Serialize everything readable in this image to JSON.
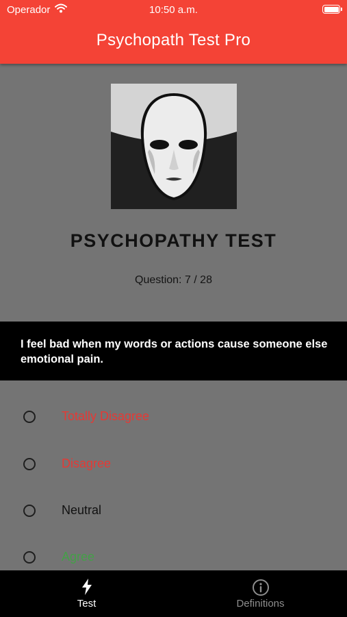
{
  "status_bar": {
    "carrier": "Operador",
    "time": "10:50 a.m."
  },
  "header": {
    "title": "Psychopath Test Pro"
  },
  "main": {
    "title": "PSYCHOPATHY TEST",
    "question_counter": "Question: 7 / 28",
    "question_text": "I feel bad when my words or actions cause someone else emotional pain.",
    "options": [
      {
        "label": "Totally Disagree",
        "color": "#e53935"
      },
      {
        "label": "Disagree",
        "color": "#e53935"
      },
      {
        "label": "Neutral",
        "color": "#111111"
      },
      {
        "label": "Agree",
        "color": "#43a047"
      }
    ]
  },
  "tabbar": {
    "tabs": [
      {
        "label": "Test",
        "icon": "lightning-bolt-icon",
        "active": true
      },
      {
        "label": "Definitions",
        "icon": "info-circle-icon",
        "active": false
      }
    ]
  },
  "colors": {
    "header_bg": "#f44336",
    "content_bg": "#747474",
    "question_bg": "#000000",
    "tabbar_bg": "#000000",
    "tab_active": "#ffffff",
    "tab_inactive": "#8e8e8e"
  }
}
